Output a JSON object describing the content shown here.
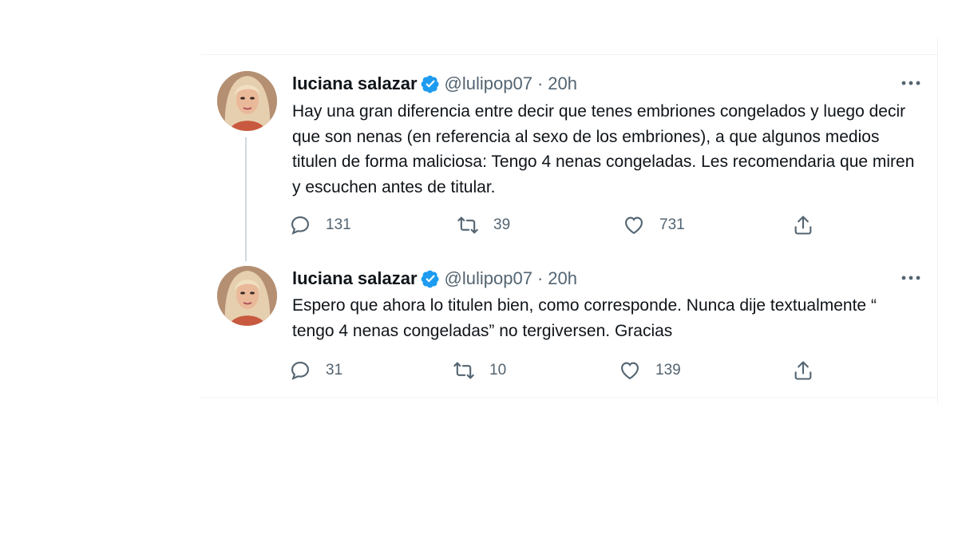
{
  "colors": {
    "text": "#0f1419",
    "secondary": "#536471",
    "verified": "#1d9bf0",
    "border": "#eff3f4",
    "thread_line": "#cfd9de"
  },
  "tweets": [
    {
      "author": "luciana salazar",
      "handle": "@lulipop07",
      "separator": "·",
      "time": "20h",
      "verified_icon": "verified-badge-icon",
      "text": "Hay una gran diferencia entre decir que tenes embriones congelados y luego decir que son nenas (en referencia al sexo de los embriones), a que algunos medios titulen de forma maliciosa: Tengo 4 nenas congeladas. Les recomendaria que miren y escuchen antes de titular.",
      "replies": "131",
      "retweets": "39",
      "likes": "731"
    },
    {
      "author": "luciana salazar",
      "handle": "@lulipop07",
      "separator": "·",
      "time": "20h",
      "verified_icon": "verified-badge-icon",
      "text": "Espero que ahora lo titulen bien, como corresponde. Nunca dije textualmente “ tengo 4 nenas congeladas” no tergiversen. Gracias",
      "replies": "31",
      "retweets": "10",
      "likes": "139"
    }
  ]
}
